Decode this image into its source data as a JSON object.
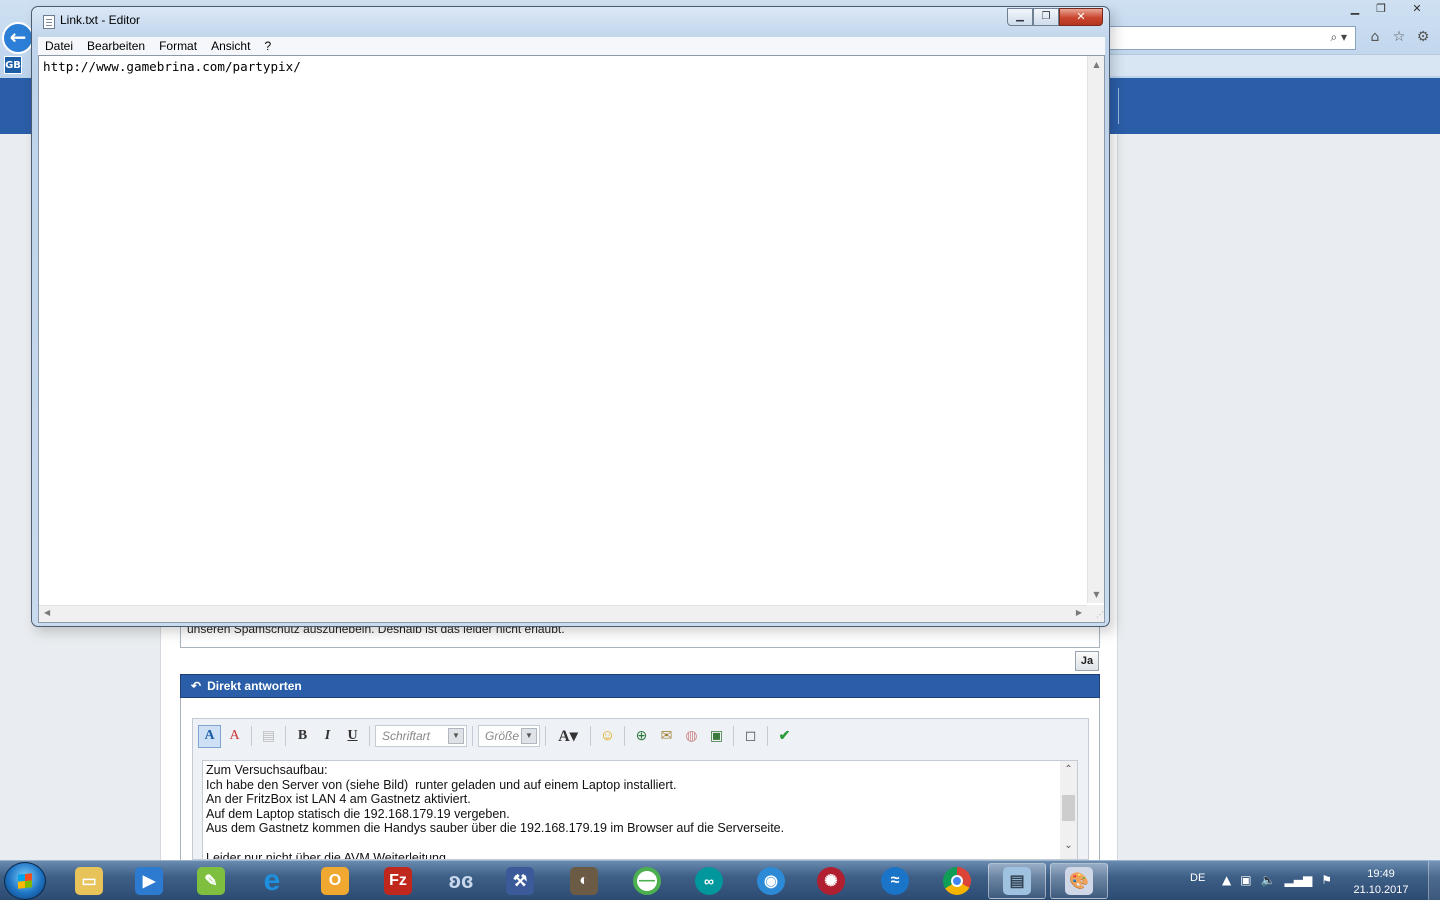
{
  "notepad": {
    "title": "Link.txt - Editor",
    "controls": {
      "minimize": "▁",
      "maximize": "❐",
      "close": "✕"
    },
    "menu": [
      "Datei",
      "Bearbeiten",
      "Format",
      "Ansicht",
      "?"
    ],
    "content": "http://www.gamebrina.com/partypix/"
  },
  "browser": {
    "back_icon": "arrow-left-icon",
    "search_icon": "search-icon",
    "toolbar_icons": [
      "home-icon",
      "star-icon",
      "gear-icon"
    ],
    "header_color": "#2b5ea8"
  },
  "forum": {
    "notice_text": "unseren Spamschutz auszuhebeln. Deshalb ist das leider nicht erlaubt.",
    "yes_button": "Ja",
    "reply_header": "Direkt antworten",
    "font_select_placeholder": "Schriftart",
    "size_select_placeholder": "Größe",
    "message_lines": [
      "Zum Versuchsaufbau:",
      "Ich habe den Server von (siehe Bild)  runter geladen und auf einem Laptop installiert.",
      "An der FritzBox ist LAN 4 am Gastnetz aktiviert.",
      "Auf dem Laptop statisch die 192.168.179.19 vergeben.",
      "Aus dem Gastnetz kommen die Handys sauber über die 192.168.179.19 im Browser auf die Serverseite.",
      "",
      "Leider nur nicht über die AVM Weiterleitung"
    ]
  },
  "taskbar": {
    "apps": [
      {
        "name": "explorer-icon",
        "color": "#e8c35a"
      },
      {
        "name": "media-player-icon",
        "color": "#2d7bd0"
      },
      {
        "name": "notepadpp-icon",
        "color": "#7fbf3f"
      },
      {
        "name": "internet-explorer-icon",
        "color": "#1e90e0"
      },
      {
        "name": "outlook-icon",
        "color": "#f0a830"
      },
      {
        "name": "filezilla-icon",
        "color": "#c0271d"
      },
      {
        "name": "butterfly-icon",
        "color": "#4a6e9a"
      },
      {
        "name": "tool-icon",
        "color": "#3a5a9a"
      },
      {
        "name": "gimp-icon",
        "color": "#6b5b45"
      },
      {
        "name": "green-ring-icon",
        "color": "#4caf50"
      },
      {
        "name": "arduino-icon",
        "color": "#00979d"
      },
      {
        "name": "globe-icon",
        "color": "#2d8ad6"
      },
      {
        "name": "red-app-icon",
        "color": "#b02030"
      },
      {
        "name": "blue-wave-icon",
        "color": "#1a74c8"
      },
      {
        "name": "chrome-icon",
        "color": "#db4437"
      },
      {
        "name": "notepad-icon",
        "color": "#9fc2e0"
      },
      {
        "name": "paint-icon",
        "color": "#d0d8e8"
      }
    ],
    "language": "DE",
    "time": "19:49",
    "date": "21.10.2017"
  }
}
